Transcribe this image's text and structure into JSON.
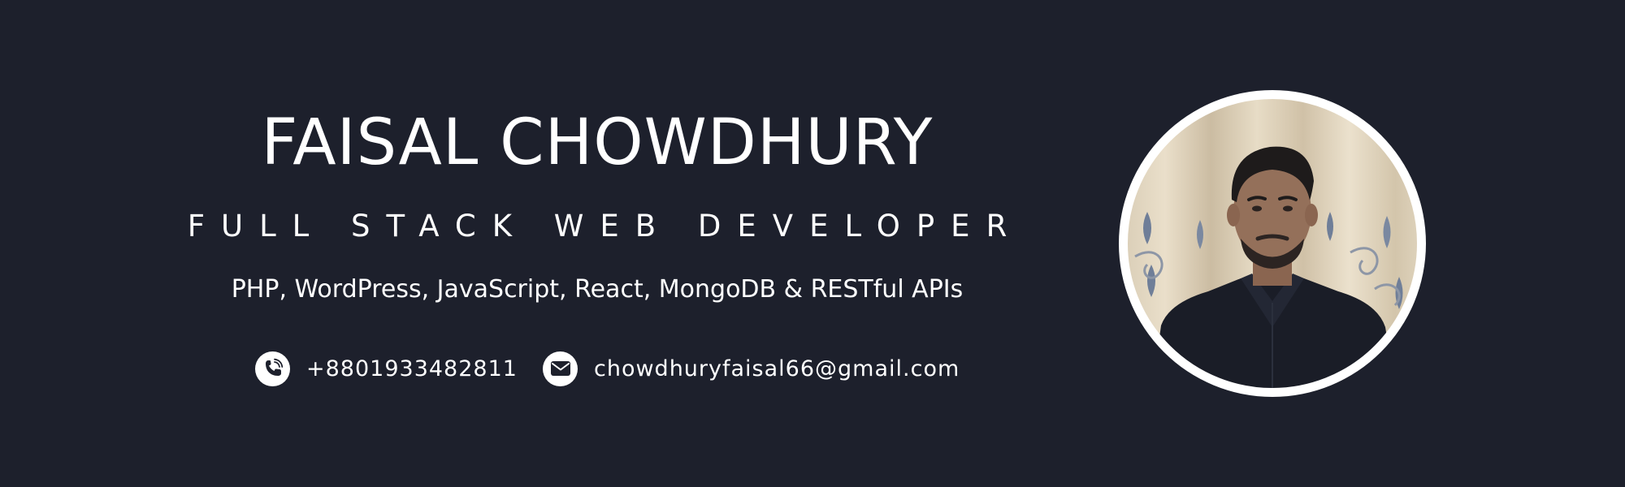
{
  "profile": {
    "name": "FAISAL CHOWDHURY",
    "role": "FULL STACK WEB DEVELOPER",
    "skills": "PHP, WordPress, JavaScript, React, MongoDB & RESTful APIs"
  },
  "contacts": {
    "phone": {
      "icon": "phone-icon",
      "value": "+8801933482811"
    },
    "email": {
      "icon": "mail-icon",
      "value": "chowdhuryfaisal66@gmail.com"
    }
  },
  "colors": {
    "background": "#1d202c",
    "text": "#ffffff",
    "photo_border": "#ffffff"
  }
}
